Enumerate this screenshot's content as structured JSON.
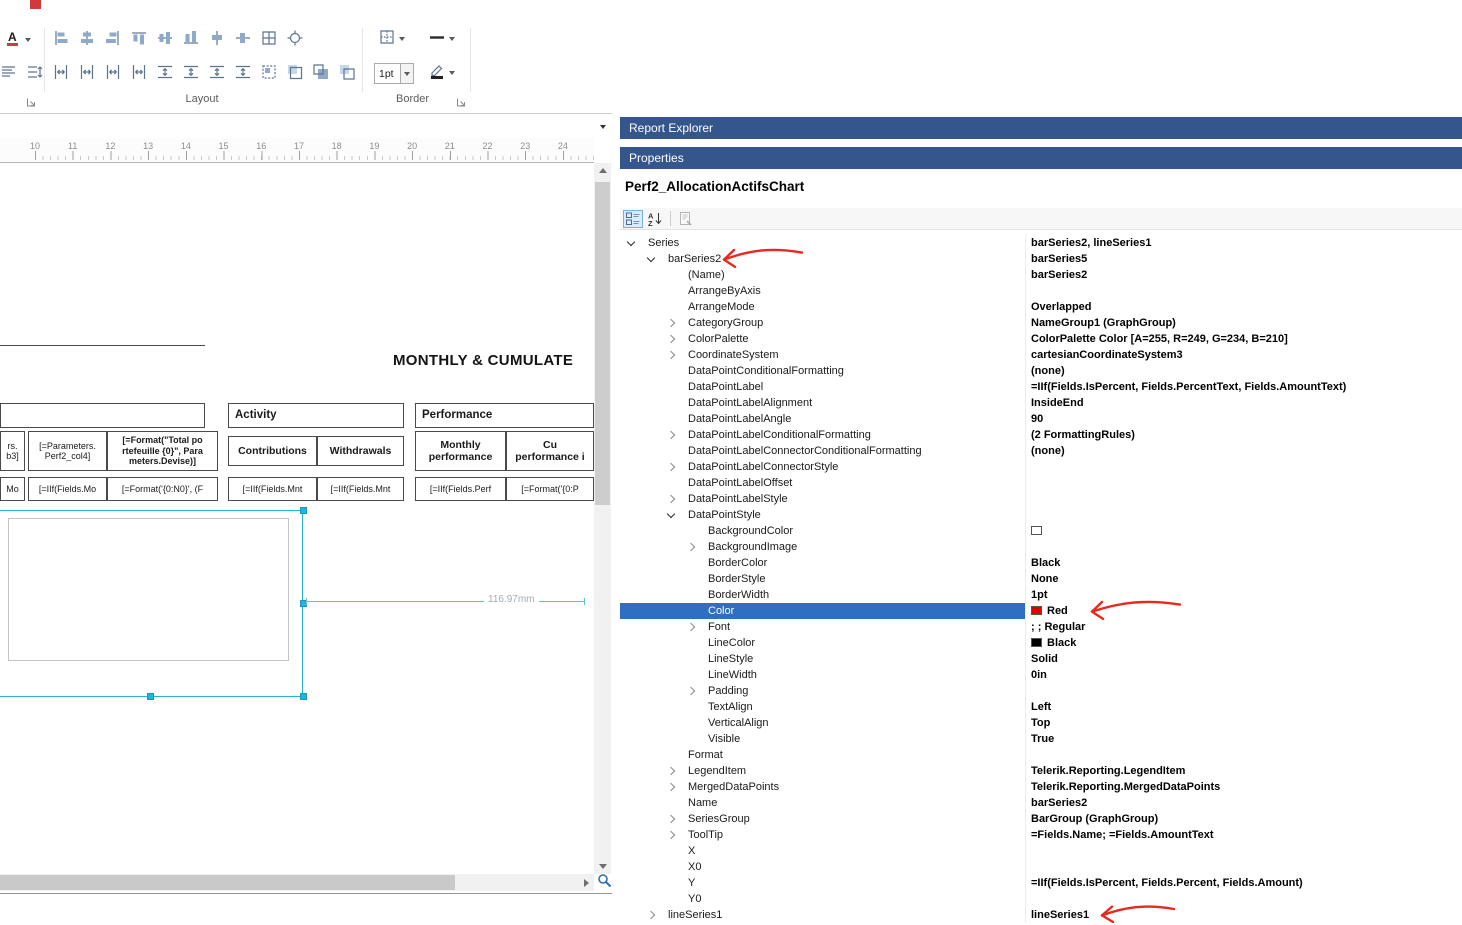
{
  "colors": {
    "titlebar_blue": "#35568C",
    "selection_blue": "#2f6fc1",
    "annotation_red": "#e8291f",
    "handle_cyan": "#27b2d7",
    "swatch_red": "#e00000",
    "swatch_black": "#000000",
    "swatch_white": "#ffffff"
  },
  "toolbar": {
    "left_group": {
      "row1": [
        "font-color-icon"
      ],
      "row2": [
        "text-align-icon",
        "line-spacing-icon"
      ]
    },
    "layout_group": {
      "label": "Layout",
      "row1": [
        "align-lefts-icon",
        "align-centers-icon",
        "align-rights-icon",
        "align-tops-icon",
        "align-middles-icon",
        "align-bottoms-icon",
        "center-horizontally-icon",
        "center-vertically-icon",
        "size-to-grid-icon",
        "snap-to-grid-icon"
      ],
      "row2": [
        "equal-horizontal-spacing-icon",
        "increase-horizontal-spacing-icon",
        "decrease-horizontal-spacing-icon",
        "remove-horizontal-spacing-icon",
        "equal-vertical-spacing-icon",
        "increase-vertical-spacing-icon",
        "decrease-vertical-spacing-icon",
        "remove-vertical-spacing-icon",
        "align-to-grid-icon",
        "size-to-control-icon",
        "bring-to-front-icon",
        "send-to-back-icon"
      ]
    },
    "border_group": {
      "label": "Border",
      "width_value": "1pt",
      "row1": [
        "borders-icon",
        "line-style-icon"
      ],
      "row2": [
        "border-color-icon"
      ]
    }
  },
  "design": {
    "ruler": [
      "10",
      "11",
      "12",
      "13",
      "14",
      "15",
      "16",
      "17",
      "18",
      "19",
      "20",
      "21",
      "22",
      "23",
      "24"
    ],
    "title": "MONTHLY & CUMULATE",
    "headers": [
      "Activity",
      "Performance"
    ],
    "row1": [
      "rs.\nb3]",
      "[=Parameters.\nPerf2_col4]",
      "[=Format(\"Total po\nrtefeuille {0}\", Para\nmeters.Devise)]",
      "Contributions",
      "Withdrawals",
      "Monthly\nperformance",
      "Cu\nperformance i"
    ],
    "row2": [
      "Mo",
      "[=IIf(Fields.Mo",
      "[=Format('{0:N0}', (F",
      "[=IIf(Fields.Mnt",
      "[=IIf(Fields.Mnt",
      "[=IIf(Fields.Perf",
      "[=Format('{0:P"
    ],
    "dimension": "116.97mm"
  },
  "report_explorer": {
    "title": "Report Explorer"
  },
  "properties_panel": {
    "title": "Properties",
    "object_name": "Perf2_AllocationActifsChart",
    "toolbar": [
      "categorized-icon",
      "alphabetical-sort-icon",
      "property-pages-icon"
    ],
    "rows": [
      {
        "n": "Series",
        "v": "barSeries2, lineSeries1",
        "i": 0,
        "e": "open"
      },
      {
        "n": "barSeries2",
        "v": "barSeries5",
        "i": 1,
        "e": "open"
      },
      {
        "n": "(Name)",
        "v": "barSeries2",
        "i": 2,
        "e": "none"
      },
      {
        "n": "ArrangeByAxis",
        "v": "",
        "i": 2,
        "e": "none"
      },
      {
        "n": "ArrangeMode",
        "v": "Overlapped",
        "i": 2,
        "e": "none"
      },
      {
        "n": "CategoryGroup",
        "v": "NameGroup1 (GraphGroup)",
        "i": 2,
        "e": "closed"
      },
      {
        "n": "ColorPalette",
        "v": "ColorPalette Color [A=255, R=249, G=234, B=210]",
        "i": 2,
        "e": "closed"
      },
      {
        "n": "CoordinateSystem",
        "v": "cartesianCoordinateSystem3",
        "i": 2,
        "e": "closed"
      },
      {
        "n": "DataPointConditionalFormatting",
        "v": "(none)",
        "i": 2,
        "e": "none"
      },
      {
        "n": "DataPointLabel",
        "v": "=IIf(Fields.IsPercent, Fields.PercentText, Fields.AmountText)",
        "i": 2,
        "e": "none"
      },
      {
        "n": "DataPointLabelAlignment",
        "v": "InsideEnd",
        "i": 2,
        "e": "none"
      },
      {
        "n": "DataPointLabelAngle",
        "v": "90",
        "i": 2,
        "e": "none"
      },
      {
        "n": "DataPointLabelConditionalFormatting",
        "v": "(2 FormattingRules)",
        "i": 2,
        "e": "closed"
      },
      {
        "n": "DataPointLabelConnectorConditionalFormatting",
        "v": "(none)",
        "i": 2,
        "e": "none"
      },
      {
        "n": "DataPointLabelConnectorStyle",
        "v": "",
        "i": 2,
        "e": "closed"
      },
      {
        "n": "DataPointLabelOffset",
        "v": "",
        "i": 2,
        "e": "none"
      },
      {
        "n": "DataPointLabelStyle",
        "v": "",
        "i": 2,
        "e": "closed"
      },
      {
        "n": "DataPointStyle",
        "v": "",
        "i": 2,
        "e": "open"
      },
      {
        "n": "BackgroundColor",
        "v": "",
        "i": 3,
        "e": "none",
        "sw": "#ffffff"
      },
      {
        "n": "BackgroundImage",
        "v": "",
        "i": 3,
        "e": "closed"
      },
      {
        "n": "BorderColor",
        "v": "Black",
        "i": 3,
        "e": "none"
      },
      {
        "n": "BorderStyle",
        "v": "None",
        "i": 3,
        "e": "none"
      },
      {
        "n": "BorderWidth",
        "v": "1pt",
        "i": 3,
        "e": "none"
      },
      {
        "n": "Color",
        "v": "Red",
        "i": 3,
        "e": "none",
        "sw": "#e00000",
        "sel": true
      },
      {
        "n": "Font",
        "v": "; ; Regular",
        "i": 3,
        "e": "closed"
      },
      {
        "n": "LineColor",
        "v": "Black",
        "i": 3,
        "e": "none",
        "sw": "#000000"
      },
      {
        "n": "LineStyle",
        "v": "Solid",
        "i": 3,
        "e": "none"
      },
      {
        "n": "LineWidth",
        "v": "0in",
        "i": 3,
        "e": "none"
      },
      {
        "n": "Padding",
        "v": "",
        "i": 3,
        "e": "closed"
      },
      {
        "n": "TextAlign",
        "v": "Left",
        "i": 3,
        "e": "none"
      },
      {
        "n": "VerticalAlign",
        "v": "Top",
        "i": 3,
        "e": "none"
      },
      {
        "n": "Visible",
        "v": "True",
        "i": 3,
        "e": "none"
      },
      {
        "n": "Format",
        "v": "",
        "i": 2,
        "e": "none"
      },
      {
        "n": "LegendItem",
        "v": "Telerik.Reporting.LegendItem",
        "i": 2,
        "e": "closed"
      },
      {
        "n": "MergedDataPoints",
        "v": "Telerik.Reporting.MergedDataPoints",
        "i": 2,
        "e": "closed"
      },
      {
        "n": "Name",
        "v": "barSeries2",
        "i": 2,
        "e": "none"
      },
      {
        "n": "SeriesGroup",
        "v": "BarGroup (GraphGroup)",
        "i": 2,
        "e": "closed"
      },
      {
        "n": "ToolTip",
        "v": "=Fields.Name; =Fields.AmountText",
        "i": 2,
        "e": "closed"
      },
      {
        "n": "X",
        "v": "",
        "i": 2,
        "e": "none"
      },
      {
        "n": "X0",
        "v": "",
        "i": 2,
        "e": "none"
      },
      {
        "n": "Y",
        "v": "=IIf(Fields.IsPercent, Fields.Percent, Fields.Amount)",
        "i": 2,
        "e": "none"
      },
      {
        "n": "Y0",
        "v": "",
        "i": 2,
        "e": "none"
      },
      {
        "n": "lineSeries1",
        "v": "lineSeries1",
        "i": 1,
        "e": "closed"
      }
    ]
  },
  "annotations": [
    {
      "shape": "hand-drawn-arrow",
      "points_to": "barSeries2 series node"
    },
    {
      "shape": "hand-drawn-arrow",
      "points_to": "Color property value Red"
    },
    {
      "shape": "hand-drawn-arrow",
      "points_to": "lineSeries1 series node"
    }
  ]
}
